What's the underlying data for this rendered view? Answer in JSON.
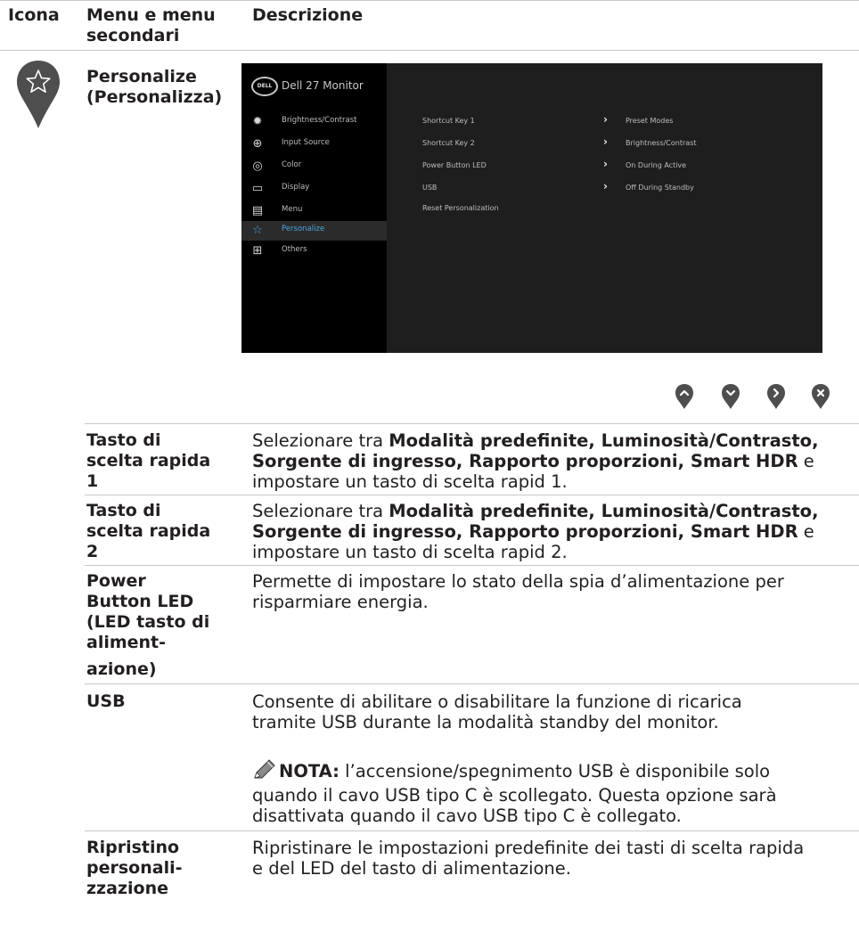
{
  "header": {
    "col1": "Icona",
    "col2_line1": "Menu e menu",
    "col2_line2": "secondari",
    "col3": "Descrizione"
  },
  "section": {
    "icon": "star-icon",
    "title_line1": "Personalize",
    "title_line2": "(Personalizza)"
  },
  "osd": {
    "logo": "DELL",
    "title": "Dell 27 Monitor",
    "menu": [
      {
        "icon": "brightness-icon",
        "label": "Brightness/Contrast"
      },
      {
        "icon": "input-source-icon",
        "label": "Input Source"
      },
      {
        "icon": "color-icon",
        "label": "Color"
      },
      {
        "icon": "display-icon",
        "label": "Display"
      },
      {
        "icon": "menu-icon",
        "label": "Menu"
      },
      {
        "icon": "star-icon",
        "label": "Personalize",
        "selected": true
      },
      {
        "icon": "others-icon",
        "label": "Others"
      }
    ],
    "options": [
      {
        "label": "Shortcut Key 1",
        "value": "Preset Modes"
      },
      {
        "label": "Shortcut Key 2",
        "value": "Brightness/Contrast"
      },
      {
        "label": "Power Button LED",
        "value": "On During Active"
      },
      {
        "label": "USB",
        "value": "Off During Standby"
      },
      {
        "label": "Reset Personalization",
        "value": ""
      }
    ],
    "highlight_color": "#4aa3df"
  },
  "nav_buttons": [
    "up-icon",
    "down-icon",
    "right-icon",
    "close-icon"
  ],
  "rows": {
    "shortcut1": {
      "label": [
        "Tasto di",
        "scelta rapida",
        "1"
      ],
      "d1_pre": "Selezionare tra ",
      "d1_bold": "Modalità predefinite, Luminosità/Contrasto,",
      "d2_bold": "Sorgente di ingresso, Rapporto proporzioni, Smart HDR",
      "d2_post": " e",
      "d3": "impostare un tasto di scelta rapid 1."
    },
    "shortcut2": {
      "label": [
        "Tasto di",
        "scelta rapida",
        "2"
      ],
      "d1_pre": "Selezionare tra ",
      "d1_bold": "Modalità predefinite, Luminosità/Contrasto,",
      "d2_bold": "Sorgente di ingresso, Rapporto proporzioni, Smart HDR",
      "d2_post": " e",
      "d3": "impostare un tasto di scelta rapid 2."
    },
    "power_led": {
      "label": [
        "Power",
        "Button LED",
        "(LED tasto di",
        "aliment-",
        "azione)"
      ],
      "d1": "Permette di impostare lo stato della spia d’alimentazione per",
      "d2": "risparmiare energia."
    },
    "usb": {
      "label": "USB",
      "d1": "Consente di abilitare o disabilitare la funzione di ricarica",
      "d2": "tramite USB durante la modalità standby del monitor.",
      "note_bold": "NOTA:",
      "note1": " l’accensione/spegnimento USB è disponibile solo",
      "note2": "quando il cavo USB tipo C è scollegato. Questa opzione sarà",
      "note3": "disattivata quando il cavo USB tipo C è collegato."
    },
    "reset": {
      "label": [
        "Ripristino",
        "personali-",
        "zzazione"
      ],
      "d1": "Ripristinare le impostazioni predefinite dei tasti di scelta rapida",
      "d2": "e del LED del tasto di alimentazione."
    }
  }
}
